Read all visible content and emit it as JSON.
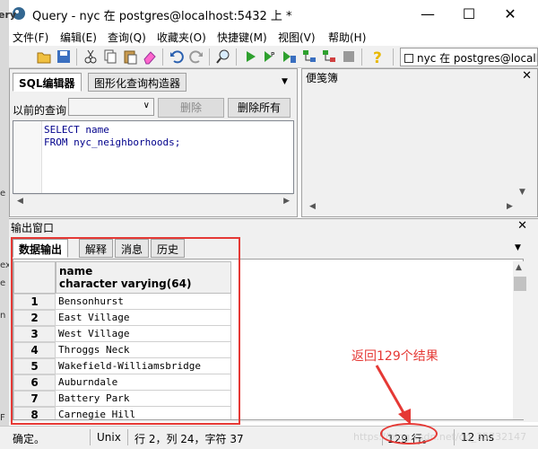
{
  "window": {
    "title": "Query - nyc 在  postgres@localhost:5432 上 *"
  },
  "left_edge_fragments": [
    "ery",
    "e",
    "ex",
    "e",
    "n",
    "F"
  ],
  "menubar": {
    "items": [
      "文件(F)",
      "编辑(E)",
      "查询(Q)",
      "收藏夹(O)",
      "快捷键(M)",
      "视图(V)",
      "帮助(H)"
    ]
  },
  "toolbar": {
    "connection": "nyc 在  postgres@localh"
  },
  "sql_panel": {
    "tabs": [
      "SQL编辑器",
      "图形化查询构造器"
    ],
    "history_label": "以前的查询",
    "delete_label": "删除",
    "delete_all_label": "删除所有",
    "code_line1": "SELECT name",
    "code_line2": "FROM nyc_neighborhoods;"
  },
  "scratch_pad": {
    "title": "便笺簿"
  },
  "output": {
    "title": "输出窗口",
    "tabs": [
      "数据输出",
      "解释",
      "消息",
      "历史"
    ],
    "column_name": "name",
    "column_type": "character varying(64)",
    "rows": [
      {
        "n": "1",
        "v": "Bensonhurst"
      },
      {
        "n": "2",
        "v": "East Village"
      },
      {
        "n": "3",
        "v": "West Village"
      },
      {
        "n": "4",
        "v": "Throggs Neck"
      },
      {
        "n": "5",
        "v": "Wakefield-Williamsbridge"
      },
      {
        "n": "6",
        "v": "Auburndale"
      },
      {
        "n": "7",
        "v": "Battery Park"
      },
      {
        "n": "8",
        "v": "Carnegie Hill"
      }
    ]
  },
  "annotation": {
    "text": "返回129个结果",
    "color": "#e53935"
  },
  "statusbar": {
    "state": "确定。",
    "eol": "Unix",
    "position": "行 2，列 24，字符 37",
    "rows": "129 行。",
    "time": "12 ms",
    "watermark": "https://blog.csdn.net/qq_35732147"
  }
}
